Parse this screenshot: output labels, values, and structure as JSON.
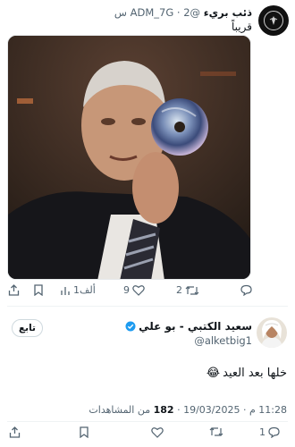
{
  "tweet": {
    "author_name": "ذئب بريء",
    "handle": "@ADM_7G",
    "time_ago": "2 س",
    "separator": "·",
    "text": "قريباً",
    "media_icon": "image-media",
    "actions": {
      "replies": "",
      "retweets": "2",
      "likes": "9",
      "views": "1ألف",
      "bookmark_icon": "bookmark-icon",
      "share_icon": "share-icon"
    }
  },
  "reply": {
    "author_name": "سعيد الكتبي - بو علي",
    "handle": "@alketbig1",
    "follow_label": "تابع",
    "text": "خلها بعد العيد",
    "emoji": "😂",
    "date": "19/03/2025",
    "time": "11:28 م",
    "views_count": "182",
    "views_label": "من المشاهدات",
    "separator": "·",
    "actions": {
      "replies": "1",
      "retweets": "",
      "likes": "",
      "bookmark_icon": "bookmark-icon",
      "share_icon": "share-icon"
    }
  },
  "colors": {
    "text": "#0f1419",
    "secondary": "#536471",
    "verified": "#1d9bf0",
    "border": "#cfd9de"
  }
}
